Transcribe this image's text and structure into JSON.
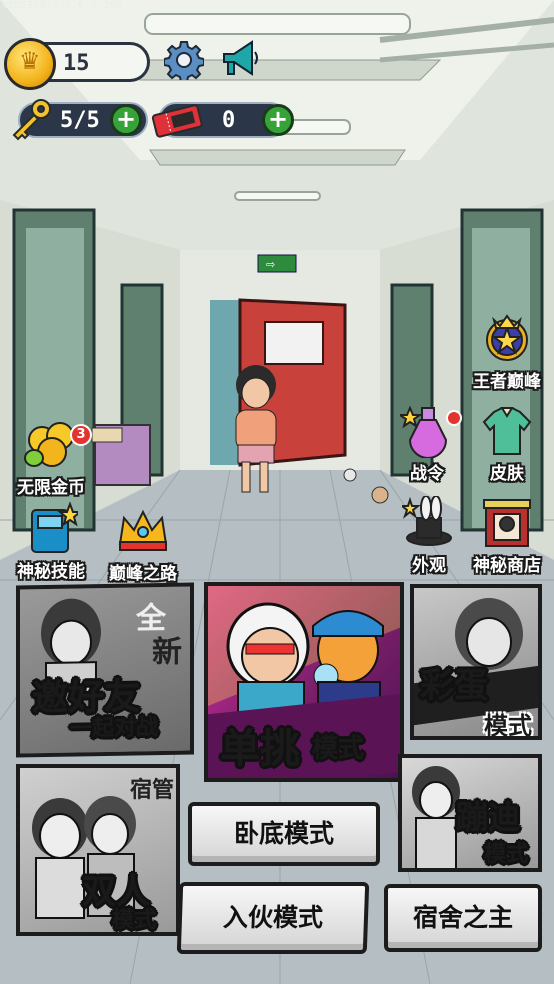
{
  "version_text": "VERSION:1.1.6.3.298",
  "hud": {
    "coins": "15",
    "keys": "5/5",
    "tickets": "0"
  },
  "icons": {
    "settings": "gear-icon",
    "announcement": "megaphone-icon"
  },
  "side_left": {
    "infinite_gold": {
      "label": "无限金币",
      "badge": "3"
    },
    "mystery_skill": {
      "label": "神秘技能"
    },
    "peak_road": {
      "label": "巅峰之路"
    }
  },
  "side_right": {
    "king_peak": {
      "label": "王者巅峰"
    },
    "battle_pass": {
      "label": "战令"
    },
    "skin": {
      "label": "皮肤"
    },
    "appearance": {
      "label": "外观"
    },
    "mystery_shop": {
      "label": "神秘商店"
    }
  },
  "modes": {
    "invite": {
      "title": "邀好友",
      "subtitle": "一起对战",
      "tag1": "全",
      "tag2": "新"
    },
    "solo": {
      "title": "单挑",
      "suffix": "模式"
    },
    "egg": {
      "title": "彩蛋",
      "suffix": "模式"
    },
    "duo": {
      "tag": "宿管",
      "title": "双人",
      "suffix": "模式"
    },
    "undercover": {
      "label": "卧底模式"
    },
    "disco": {
      "title": "蹦迪",
      "suffix": "模式"
    },
    "join": {
      "label": "入伙模式"
    },
    "master": {
      "label": "宿舍之主"
    }
  },
  "colors": {
    "accent_green": "#35a338",
    "solo_bg": "#7a1f6a",
    "door_red": "#c8413a"
  }
}
